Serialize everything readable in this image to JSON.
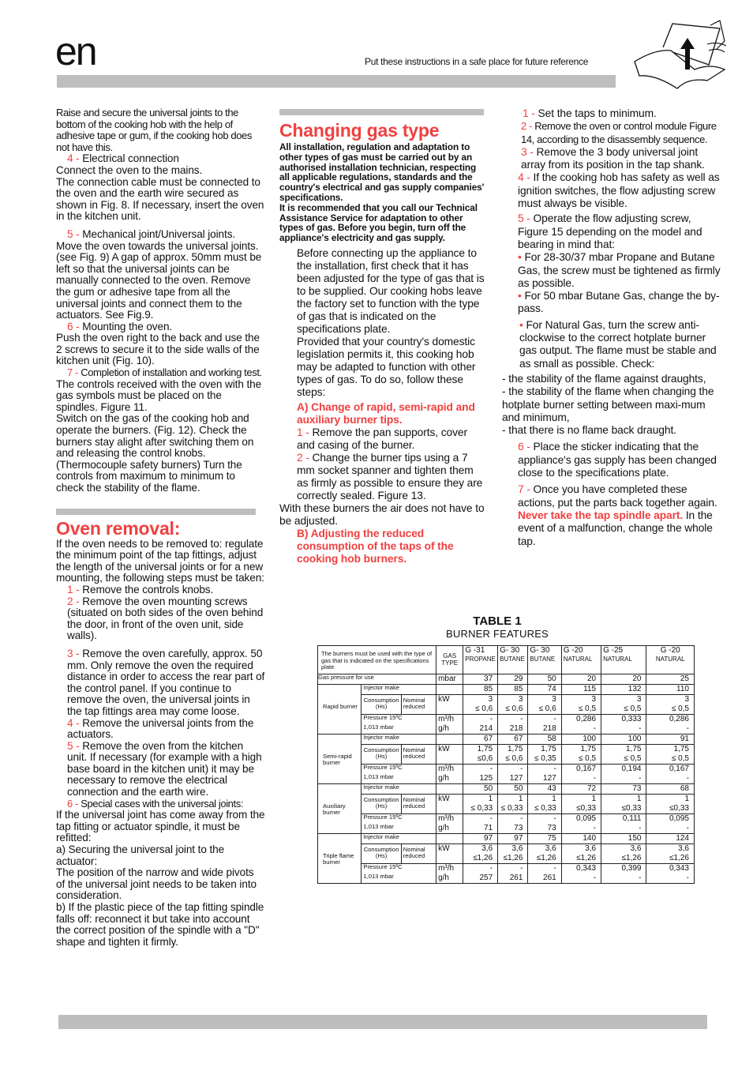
{
  "header": {
    "language_code": "en",
    "tagline": "Put these instructions in a safe place for future reference",
    "illustration_icon": "book-page-arrow-icon"
  },
  "column1": {
    "p_intro": "Raise and secure the universal joints to the bottom of the cooking hob with the help of adhesive tape or gum, if the cooking hob does not have this.",
    "step4_num": "4 -",
    "step4_title": "Electrical connection",
    "step4_l1": "Connect the oven to the mains.",
    "step4_l2": "The connection cable must be connected to the oven and the earth wire secured as shown in Fig. 8. If necessary, insert the oven in the kitchen unit.",
    "step5_num": "5 -",
    "step5_title": "Mechanical joint/Universal joints.",
    "step5_text": "Move the oven towards the universal joints. (see Fig. 9) A gap of approx. 50mm must be left so that the universal joints can be manually connected to the oven. Remove the gum or adhesive tape from all the universal joints and connect them to the actuators. See Fig.9.",
    "step6_num": "6 -",
    "step6_title": "Mounting the oven.",
    "step6_text": "Push the oven right to the back and use the 2 screws to secure it to the side walls of the kitchen unit (Fig. 10).",
    "step7_num": "7 -",
    "step7_title": "Completion of installation and working test.",
    "step7_l1": "The controls received with the oven with the gas symbols must be placed on the spindles. Figure 11.",
    "step7_l2": "Switch on the gas of the cooking hob and operate the burners. (Fig. 12). Check the burners stay alight after switching them on and releasing the control knobs. (Thermocouple safety burners) Turn the controls from maximum to minimum to check the stability of the flame.",
    "oven_removal": {
      "title": "Oven removal:",
      "intro": "If the oven needs to be removed to: regulate the minimum point of the tap fittings, adjust the length of the universal joints or for a new mounting, the following steps must be taken:",
      "steps": [
        {
          "num": "1 -",
          "text": "Remove the controls knobs."
        },
        {
          "num": "2 -",
          "text": "Remove the oven mounting screws (situated on both sides of the oven behind the door, in front of the oven unit, side walls)."
        },
        {
          "num": "3 -",
          "text": "Remove the oven carefully, approx. 50 mm. Only remove the oven the required distance in order to access the rear part of the control panel. If you continue to remove the oven, the universal joints in the tap fittings area may come loose."
        },
        {
          "num": "4 -",
          "text": "Remove the universal joints from the actuators."
        },
        {
          "num": "5 -",
          "text": "Remove the oven from the kitchen unit. If necessary (for example with a high base board in the kitchen unit) it may be necessary to remove the electrical connection and the earth wire."
        },
        {
          "num": "6 -",
          "text": "Special cases with the universal joints:"
        }
      ],
      "s6_l1": "If the universal joint has come away from the tap fitting or actuator spindle, it must be refitted:",
      "s6_l2": "a) Securing the universal joint to the actuator:",
      "s6_l3": "The position of the narrow and wide pivots of the universal joint needs to be taken into consideration.",
      "s6_l4": "b) If the plastic piece of the tap fitting spindle falls off: reconnect it but take into account the correct position of the spindle with a \"D\" shape and tighten it firmly."
    }
  },
  "column2": {
    "title": "Changing gas type",
    "warning": "All installation, regulation and adaptation to other types of gas must be carried out by an authorised installation technician, respecting all applicable regulations, standards and the country's electrical and gas supply companies' specifications.",
    "recommend": "It is recommended that you call our Technical Assistance Service for adaptation to other types of gas. Before you begin, turn off the appliance's electricity and gas supply.",
    "p1": "Before connecting up the appliance to the installation, first check that it has been adjusted for the type of gas that is to be supplied. Our cooking hobs leave the factory set to function with the type of gas that is indicated on the specifications plate.",
    "p2": "Provided that your country's domestic legislation permits it, this cooking hob may be adapted to function with other types of gas. To do so, follow these steps:",
    "sectionA": "A) Change of rapid, semi-rapid and auxiliary burner tips.",
    "a1_num": "1 -",
    "a1_text": "Remove the pan supports, cover and casing of the burner.",
    "a2_num": "2  -",
    "a2_text": "Change the burner tips using a 7 mm socket spanner and tighten them as firmly as possible to ensure they are correctly sealed. Figure 13.",
    "a_note": "With these burners the air does not have to be adjusted.",
    "sectionB": "B) Adjusting the reduced consumption of the taps of the cooking hob burners."
  },
  "column3": {
    "b1_num": "1 -",
    "b1_text": "Set the taps to minimum.",
    "b2_num": "2 -",
    "b2_text": "Remove the oven or control module Figure 14, according to the disassembly sequence.",
    "b3_num": "3 -",
    "b3_text": "Remove the 3 body universal joint array from its position in the tap shank.",
    "b4_num": "4 -",
    "b4_text": "If the cooking hob has safety as well as ignition switches, the flow adjusting screw must always be visible.",
    "b5_num": "5 -",
    "b5_text": "Operate the flow adjusting screw, Figure 15 depending on the model and bearing in mind that:",
    "bullet": "•",
    "bullet1": "For 28-30/37 mbar Propane and Butane Gas, the screw must be tightened as firmly as possible.",
    "bullet2": "For 50 mbar Butane Gas, change the by-pass.",
    "bullet3": "For Natural Gas, turn the screw anti-clockwise to the correct hotplate burner gas output. The flame must be stable and as small as possible. Check:",
    "check1": "- the stability of the flame against draughts,",
    "check2": "- the stability of the flame when changing the hotplate burner setting between maxi-mum and minimum,",
    "check3": "- that there is no flame back draught.",
    "b6_num": "6 -",
    "b6_text": "Place the sticker indicating that the appliance's gas supply has been changed close to the specifications plate.",
    "b7_num": "7 -",
    "b7_text": "Once you have completed these actions, put the parts back together again.",
    "never": "Never take the tap spindle apart.",
    "never_rest": "In the event of a malfunction, change the whole tap."
  },
  "table": {
    "title": "TABLE 1",
    "subtitle": "BURNER FEATURES",
    "header_note": "The burners must be used with the type of gas that is indicated on the specifications plate",
    "gas_type_label": "GAS TYPE",
    "columns": [
      {
        "code": "G -31",
        "name": "PROPANE"
      },
      {
        "code": "G- 30",
        "name": "BUTANE"
      },
      {
        "code": "G- 30",
        "name": "BUTANE"
      },
      {
        "code": "G -20",
        "name": "NATURAL"
      },
      {
        "code": "G -25",
        "name": "NATURAL"
      },
      {
        "code": "G -20",
        "name": "NATURAL"
      }
    ],
    "pressure_label": "Gas pressure for use",
    "pressure_unit": "mbar",
    "pressure_values": [
      "37",
      "29",
      "50",
      "20",
      "20",
      "25"
    ],
    "injector_label": "Injector make",
    "consumption_label": "Consumption (Hs)",
    "nominal_reduced_label": "Nominal reduced",
    "kw_unit": "kW",
    "pressure15_label": "Pressure 15ºC",
    "mbar1013_label": "1,013 mbar",
    "m3h_unit": "m³/h",
    "gh_unit": "g/h",
    "burners": [
      {
        "name": "Rapid burner",
        "injector": [
          "85",
          "85",
          "74",
          "115",
          "132",
          "110"
        ],
        "nominal": [
          "3",
          "3",
          "3",
          "3",
          "3",
          "3"
        ],
        "reduced": [
          "≤ 0,6",
          "≤ 0,6",
          "≤ 0,6",
          "≤ 0,5",
          "≤ 0,5",
          "≤ 0,5"
        ],
        "m3h": [
          "-",
          "-",
          "-",
          "0,286",
          "0,333",
          "0,286"
        ],
        "gh": [
          "214",
          "218",
          "218",
          "-",
          "-",
          "-"
        ]
      },
      {
        "name": "Semi-rapid burner",
        "injector": [
          "67",
          "67",
          "58",
          "100",
          "100",
          "91"
        ],
        "nominal": [
          "1,75",
          "1,75",
          "1,75",
          "1,75",
          "1,75",
          "1,75"
        ],
        "reduced": [
          "≤0,6",
          "≤ 0,6",
          "≤ 0,35",
          "≤ 0,5",
          "≤ 0,5",
          "≤ 0,5"
        ],
        "m3h": [
          "-",
          "-",
          "-",
          "0,167",
          "0,194",
          "0,167"
        ],
        "gh": [
          "125",
          "127",
          "127",
          "-",
          "-",
          "-"
        ]
      },
      {
        "name": "Auxiliary burner",
        "injector": [
          "50",
          "50",
          "43",
          "72",
          "73",
          "68"
        ],
        "nominal": [
          "1",
          "1",
          "1",
          "1",
          "1",
          "1"
        ],
        "reduced": [
          "≤ 0,33",
          "≤ 0,33",
          "≤ 0,33",
          "≤0,33",
          "≤0,33",
          "≤0,33"
        ],
        "m3h": [
          "-",
          "-",
          "-",
          "0,095",
          "0,111",
          "0,095"
        ],
        "gh": [
          "71",
          "73",
          "73",
          "-",
          "-",
          "-"
        ]
      },
      {
        "name": "Triple flame burner",
        "injector": [
          "97",
          "97",
          "75",
          "140",
          "150",
          "124"
        ],
        "nominal": [
          "3,6",
          "3,6",
          "3,6",
          "3,6",
          "3,6",
          "3,6"
        ],
        "reduced": [
          "≤1,26",
          "≤1,26",
          "≤1,26",
          "≤1,26",
          "≤1,26",
          "≤1,26"
        ],
        "m3h": [
          "-",
          "-",
          "-",
          "0,343",
          "0,399",
          "0,343"
        ],
        "gh": [
          "257",
          "261",
          "261",
          "-",
          "-",
          "-"
        ]
      }
    ]
  }
}
